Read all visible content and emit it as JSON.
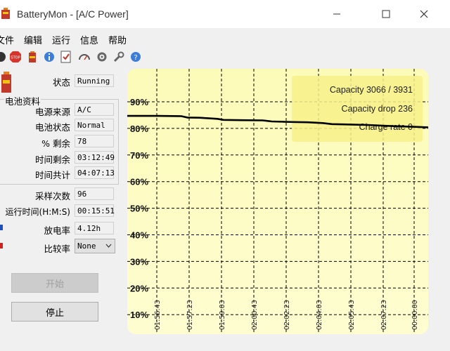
{
  "window": {
    "title": "BatteryMon - [A/C Power]"
  },
  "menu": [
    "文件",
    "编辑",
    "运行",
    "信息",
    "帮助"
  ],
  "toolbar_icons": [
    "record-icon",
    "stop-icon",
    "battery-icon",
    "info-icon",
    "check-icon",
    "gauge-icon",
    "settings-icon",
    "wrench-icon",
    "help-icon"
  ],
  "status": {
    "label": "状态",
    "value": "Running"
  },
  "group_title": "电池资料",
  "fields": [
    {
      "label": "电源来源",
      "value": "A/C"
    },
    {
      "label": "电池状态",
      "value": "Normal"
    },
    {
      "label": "% 剩余",
      "value": "78"
    },
    {
      "label": "时间剩余",
      "value": "03:12:49"
    },
    {
      "label": "时间共计",
      "value": "04:07:13"
    }
  ],
  "stats": [
    {
      "label": "采样次数",
      "value": "96"
    },
    {
      "label": "运行时间(H:M:S)",
      "value": "00:15:51"
    },
    {
      "label": "放电率",
      "value": "4.12h"
    }
  ],
  "compare": {
    "label": "比较率",
    "value": "None"
  },
  "buttons": {
    "start": "开始",
    "stop": "停止"
  },
  "colors": {
    "chart_bg": "#fdfbb8",
    "chart_info": "#f7f08a",
    "series": "#000000",
    "discharge_marker": "#2050c0",
    "compare_marker": "#d02020"
  },
  "chart_data": {
    "type": "line",
    "y_ticks": [
      "90%",
      "80%",
      "70%",
      "60%",
      "50%",
      "40%",
      "30%",
      "20%",
      "10%"
    ],
    "y_tick_values": [
      90,
      80,
      70,
      60,
      50,
      40,
      30,
      20,
      10
    ],
    "ylim": [
      10,
      90
    ],
    "x_ticks": [
      "01:56:43",
      "01:57:23",
      "01:59:03",
      "02:00:43",
      "02:02:23",
      "02:04:03",
      "02:05:43",
      "02:07:23",
      "00:00:00"
    ],
    "grid": true,
    "info_lines": [
      "Capacity 3066 / 3931",
      "Capacity drop 236",
      "Charge rate 0"
    ],
    "series": [
      {
        "values": [
          [
            0.0,
            84.7
          ],
          [
            0.1,
            84.7
          ],
          [
            0.18,
            84.6
          ],
          [
            0.2,
            84.1
          ],
          [
            0.24,
            84.0
          ],
          [
            0.3,
            83.6
          ],
          [
            0.32,
            83.2
          ],
          [
            0.38,
            83.1
          ],
          [
            0.45,
            83.0
          ],
          [
            0.48,
            82.6
          ],
          [
            0.55,
            82.4
          ],
          [
            0.6,
            82.3
          ],
          [
            0.65,
            82.0
          ],
          [
            0.68,
            81.6
          ],
          [
            0.72,
            81.5
          ],
          [
            0.8,
            81.3
          ],
          [
            0.85,
            81.0
          ],
          [
            0.9,
            80.8
          ],
          [
            0.95,
            80.6
          ],
          [
            1.0,
            80.4
          ]
        ]
      }
    ]
  }
}
